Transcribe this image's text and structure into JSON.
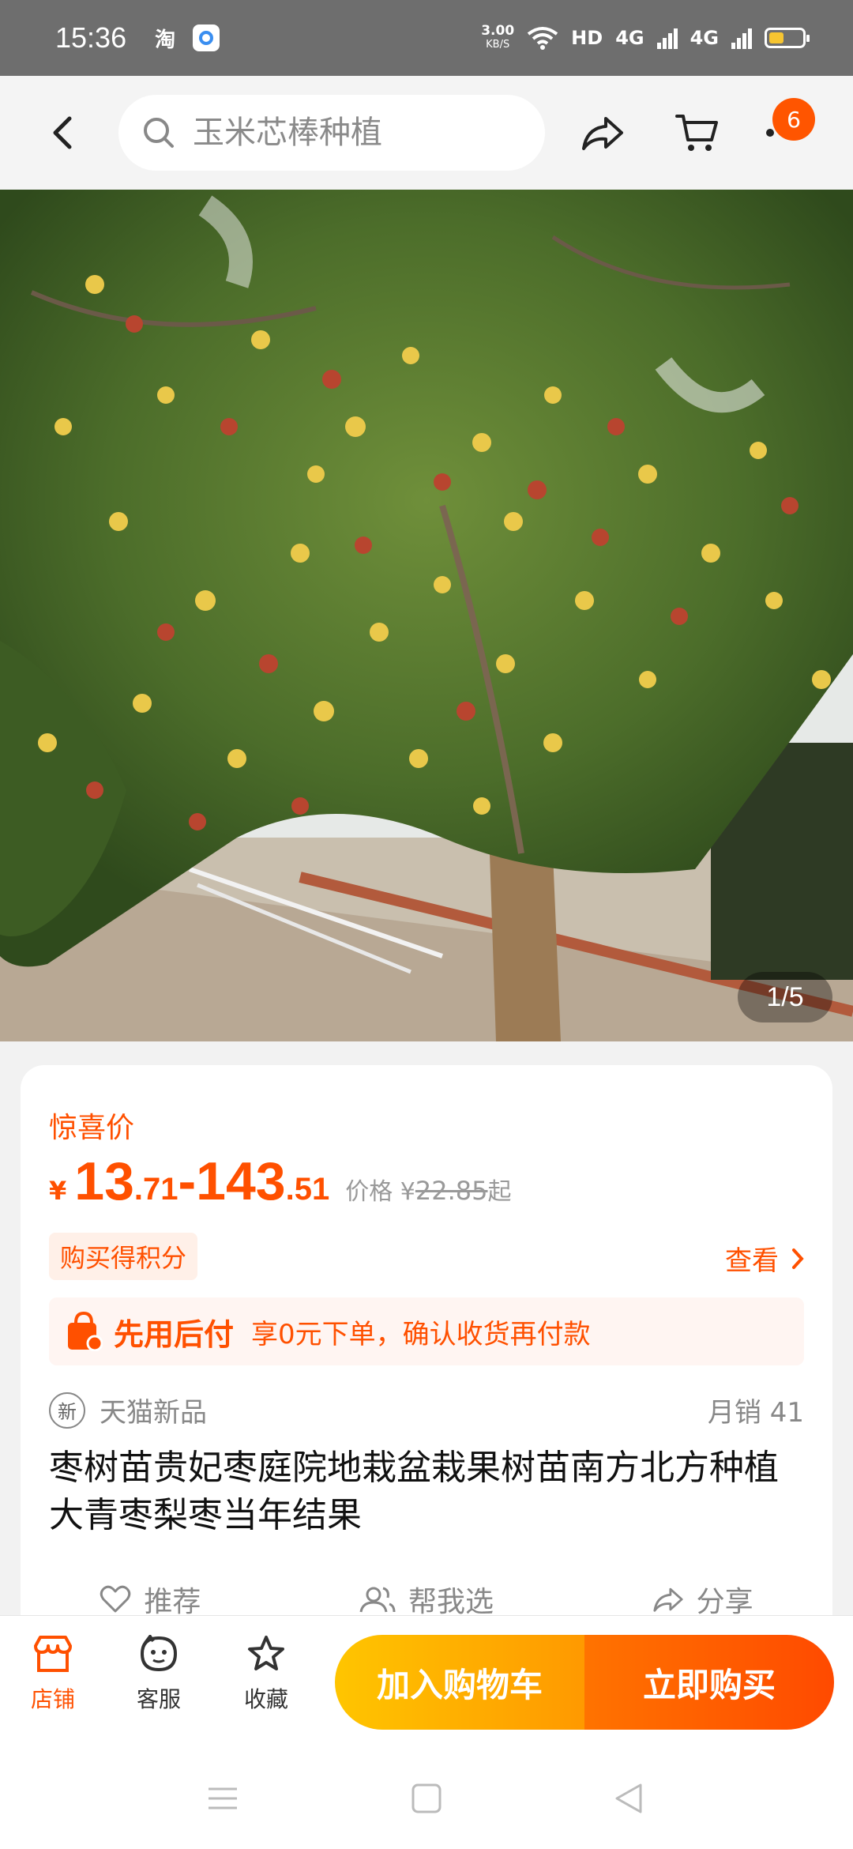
{
  "status_bar": {
    "time": "15:36",
    "app_label": "淘",
    "net_speed_value": "3.00",
    "net_speed_unit": "KB/S",
    "hd_label": "HD",
    "signal1": "4G",
    "signal2": "4G"
  },
  "search": {
    "placeholder": "玉米芯棒种植"
  },
  "cart": {
    "badge_count": "6"
  },
  "gallery": {
    "counter": "1/5"
  },
  "product": {
    "deal_label": "惊喜价",
    "currency": "¥",
    "price_low_int": "13",
    "price_low_dec": ".71",
    "price_sep": "-",
    "price_high_int": "143",
    "price_high_dec": ".51",
    "orig_prefix": "价格 ¥",
    "orig_price": "22.85",
    "orig_suffix": "起",
    "points_label": "购买得积分",
    "view_label": "查看",
    "paylater_title": "先用后付",
    "paylater_desc": "享0元下单，确认收货再付款",
    "new_badge": "新",
    "tmall_label": "天猫新品",
    "monthly_sales": "月销 41",
    "title": "枣树苗贵妃枣庭院地栽盆栽果树苗南方北方种植大青枣梨枣当年结果"
  },
  "actions": {
    "recommend": "推荐",
    "help_choose": "帮我选",
    "share": "分享"
  },
  "bottom": {
    "store": "店铺",
    "service": "客服",
    "favorite": "收藏",
    "add_to_cart": "加入购物车",
    "buy_now": "立即购买"
  },
  "colors": {
    "accent": "#ff5000",
    "cart_button": "#ffb000",
    "buy_button": "#ff5500"
  }
}
